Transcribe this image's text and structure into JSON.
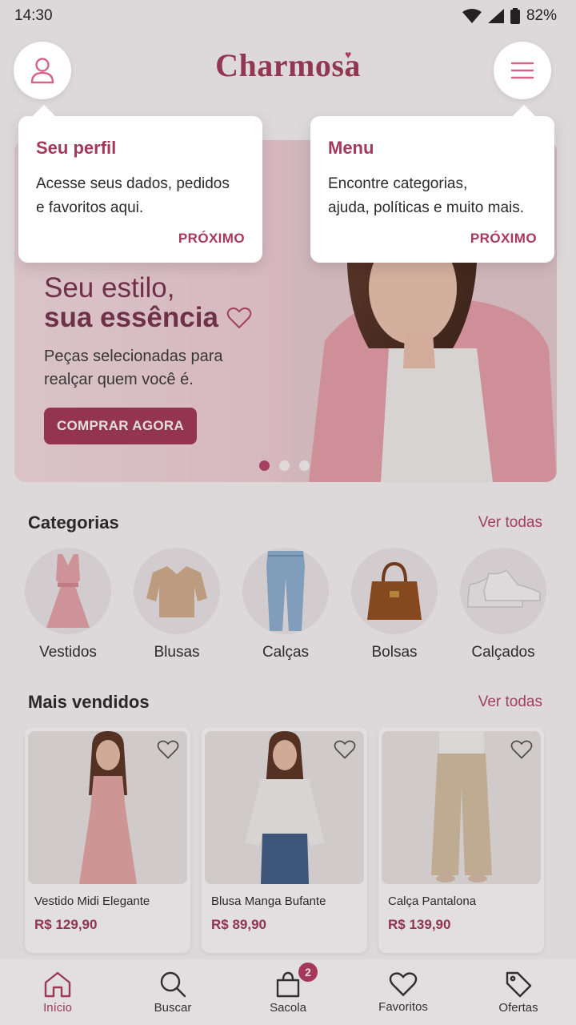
{
  "status_bar": {
    "time": "14:30",
    "battery": "82%"
  },
  "header": {
    "logo": "Charmosa"
  },
  "tooltips": {
    "profile": {
      "title": "Seu perfil",
      "body_line1": "Acesse seus dados, pedidos",
      "body_line2": "e favoritos aqui.",
      "next": "PRÓXIMO"
    },
    "menu": {
      "title": "Menu",
      "body_line1": "Encontre categorias,",
      "body_line2": "ajuda, políticas e muito mais.",
      "next": "PRÓXIMO"
    }
  },
  "hero": {
    "title_line1": "Seu estilo,",
    "title_line2": "sua essência",
    "subtitle_line1": "Peças selecionadas para",
    "subtitle_line2": "realçar quem você é.",
    "cta": "COMPRAR AGORA",
    "carousel_pages": 3,
    "carousel_active": 1
  },
  "categories": {
    "title": "Categorias",
    "see_all": "Ver todas",
    "items": [
      {
        "label": "Vestidos",
        "icon": "dress-icon"
      },
      {
        "label": "Blusas",
        "icon": "blouse-icon"
      },
      {
        "label": "Calças",
        "icon": "pants-icon"
      },
      {
        "label": "Bolsas",
        "icon": "handbag-icon"
      },
      {
        "label": "Calçados",
        "icon": "sneakers-icon"
      }
    ]
  },
  "best_sellers": {
    "title": "Mais vendidos",
    "see_all": "Ver todas",
    "products": [
      {
        "name": "Vestido Midi Elegante",
        "price": "R$ 129,90"
      },
      {
        "name": "Blusa Manga Bufante",
        "price": "R$ 89,90"
      },
      {
        "name": "Calça Pantalona",
        "price": "R$ 139,90"
      }
    ]
  },
  "bottom_nav": {
    "items": [
      {
        "label": "Início",
        "icon": "home-icon",
        "active": true
      },
      {
        "label": "Buscar",
        "icon": "search-icon"
      },
      {
        "label": "Sacola",
        "icon": "bag-icon",
        "badge": "2"
      },
      {
        "label": "Favoritos",
        "icon": "heart-icon"
      },
      {
        "label": "Ofertas",
        "icon": "tag-icon"
      }
    ]
  },
  "colors": {
    "brand": "#a5385a",
    "accent_pink": "#b5456a",
    "hero_bg": "#f4d3da"
  }
}
